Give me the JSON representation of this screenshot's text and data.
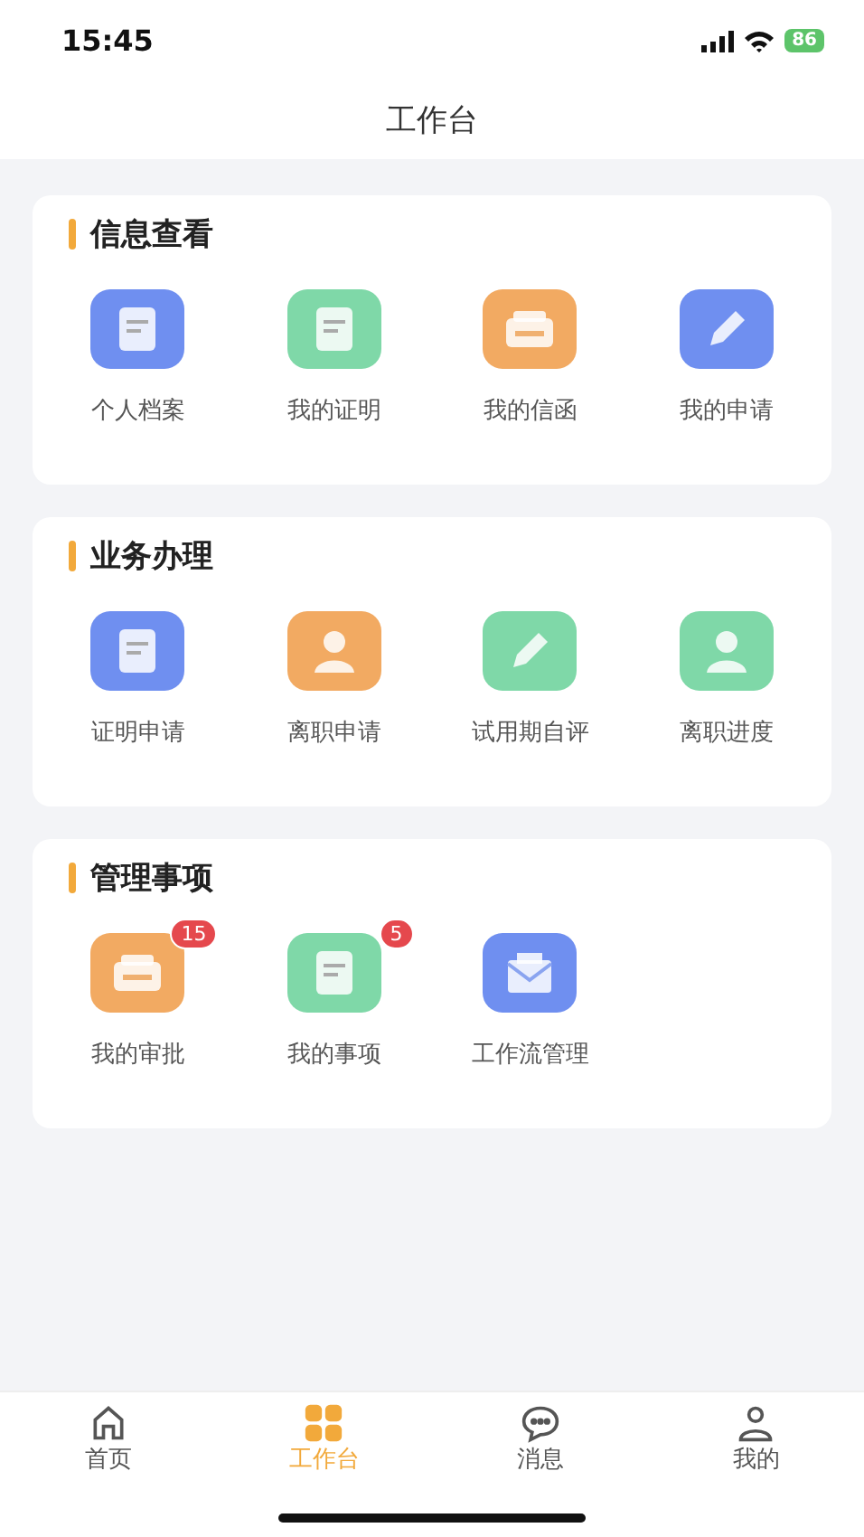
{
  "status_bar": {
    "time": "15:45",
    "battery": "86"
  },
  "header": {
    "title": "工作台"
  },
  "sections": [
    {
      "title": "信息查看",
      "items": [
        {
          "label": "个人档案",
          "kind": "document",
          "color": "#6f8ff0"
        },
        {
          "label": "我的证明",
          "kind": "document",
          "color": "#7fd8a8"
        },
        {
          "label": "我的信函",
          "kind": "box",
          "color": "#f2aa62"
        },
        {
          "label": "我的申请",
          "kind": "pencil",
          "color": "#6f8ff0"
        }
      ]
    },
    {
      "title": "业务办理",
      "items": [
        {
          "label": "证明申请",
          "kind": "document",
          "color": "#6f8ff0"
        },
        {
          "label": "离职申请",
          "kind": "person",
          "color": "#f2aa62"
        },
        {
          "label": "试用期自评",
          "kind": "pencil",
          "color": "#7fd8a8"
        },
        {
          "label": "离职进度",
          "kind": "person",
          "color": "#7fd8a8"
        }
      ]
    },
    {
      "title": "管理事项",
      "items": [
        {
          "label": "我的审批",
          "kind": "box",
          "color": "#f2aa62",
          "badge": "15"
        },
        {
          "label": "我的事项",
          "kind": "document",
          "color": "#7fd8a8",
          "badge": "5"
        },
        {
          "label": "工作流管理",
          "kind": "envelope",
          "color": "#6f8ff0"
        }
      ]
    }
  ],
  "tab_bar": [
    {
      "label": "首页",
      "kind": "home",
      "selected": false
    },
    {
      "label": "工作台",
      "kind": "grid",
      "selected": true
    },
    {
      "label": "消息",
      "kind": "chat",
      "selected": false
    },
    {
      "label": "我的",
      "kind": "person",
      "selected": false
    }
  ]
}
